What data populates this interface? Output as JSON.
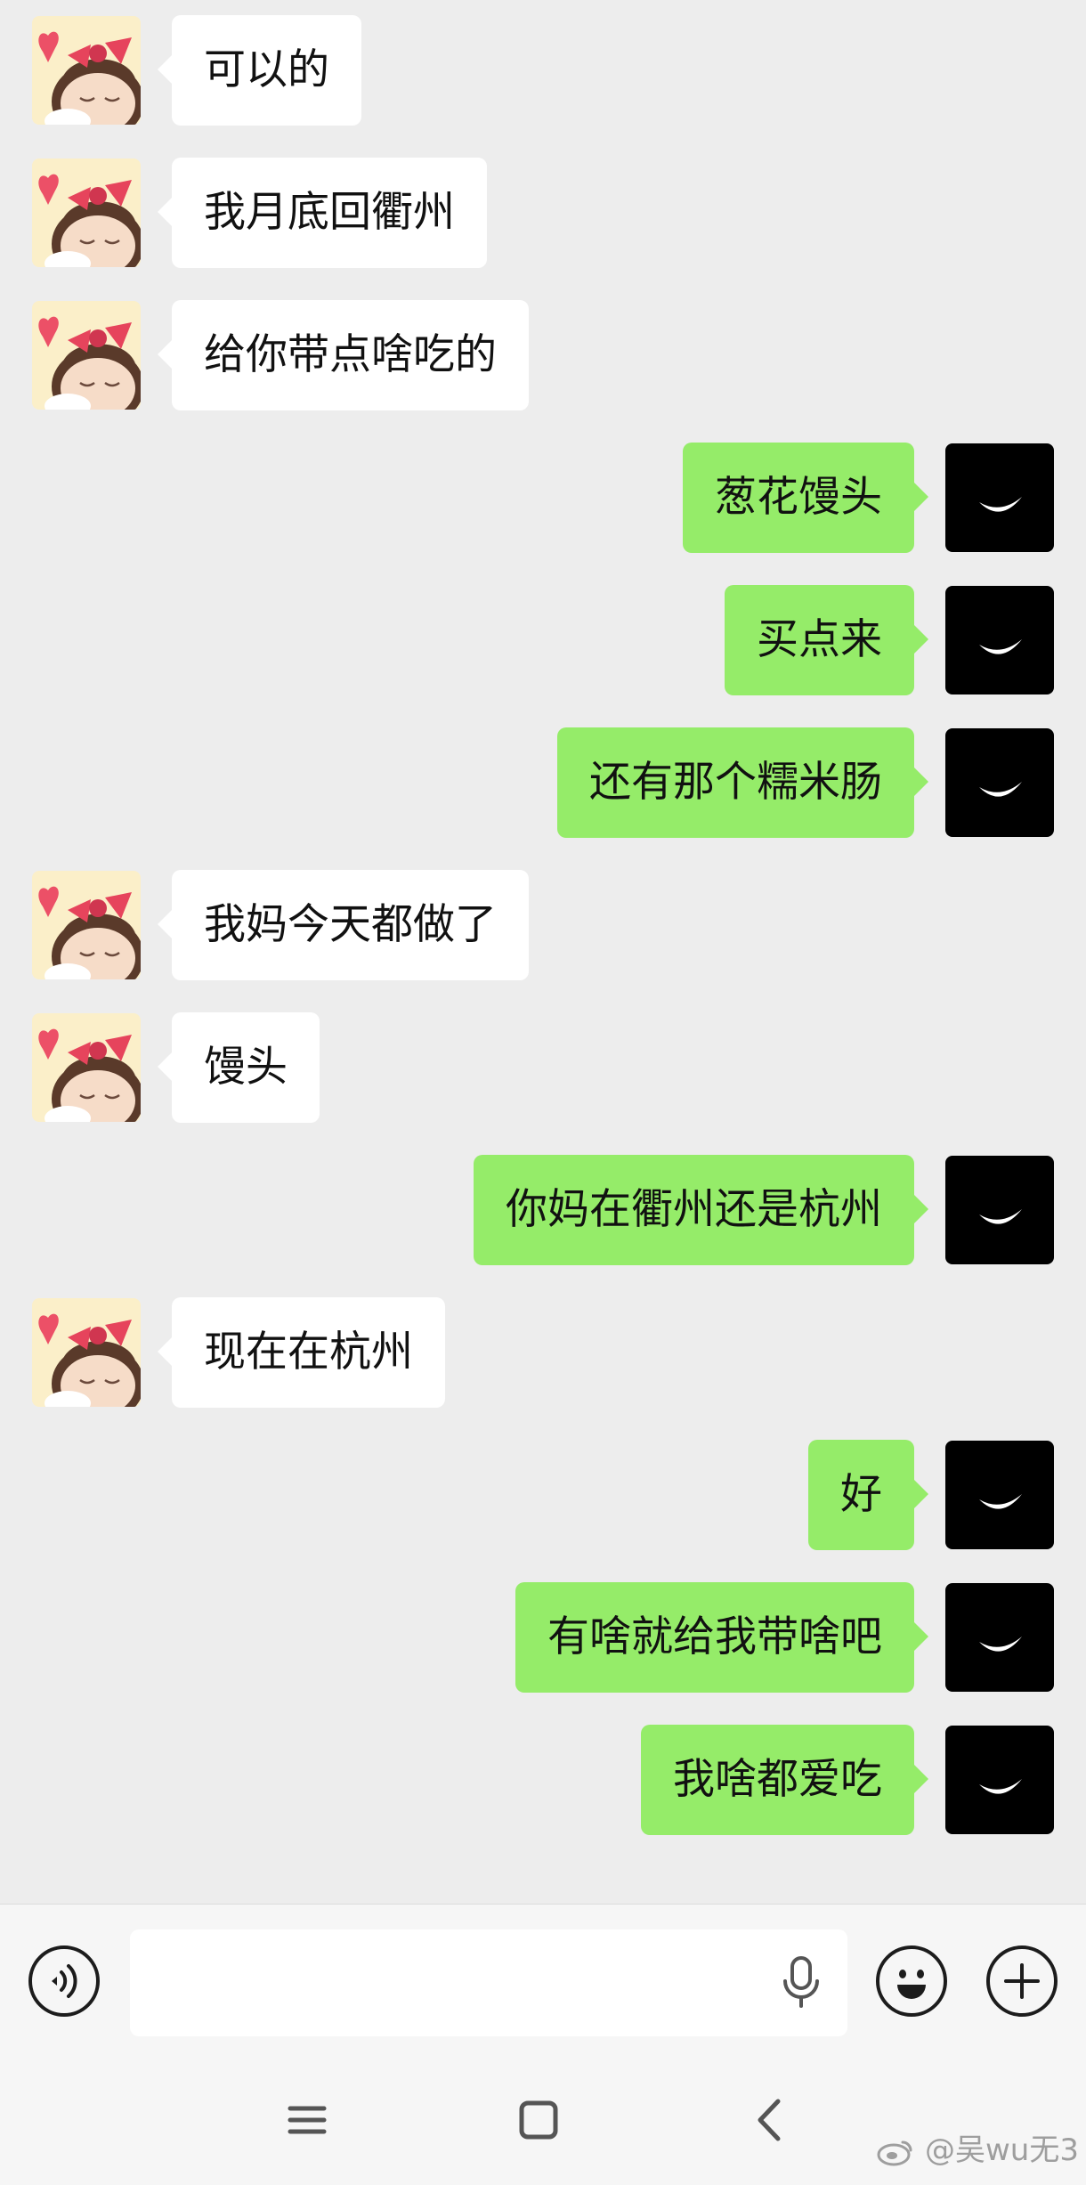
{
  "conversation": {
    "messages": [
      {
        "side": "in",
        "text": "可以的"
      },
      {
        "side": "in",
        "text": "我月底回衢州"
      },
      {
        "side": "in",
        "text": "给你带点啥吃的"
      },
      {
        "side": "out",
        "text": "葱花馒头"
      },
      {
        "side": "out",
        "text": "买点来"
      },
      {
        "side": "out",
        "text": "还有那个糯米肠"
      },
      {
        "side": "in",
        "text": "我妈今天都做了"
      },
      {
        "side": "in",
        "text": "馒头"
      },
      {
        "side": "out",
        "text": "你妈在衢州还是杭州"
      },
      {
        "side": "in",
        "text": "现在在杭州"
      },
      {
        "side": "out",
        "text": "好"
      },
      {
        "side": "out",
        "text": "有啥就给我带啥吧"
      },
      {
        "side": "out",
        "text": "我啥都爱吃"
      }
    ]
  },
  "input_bar": {
    "message_value": "",
    "icons": {
      "voice": "voice-mode-icon",
      "mic": "microphone-icon",
      "emoji": "emoji-icon",
      "plus": "plus-icon"
    }
  },
  "nav_bar": {
    "icons": [
      "menu-icon",
      "home-icon",
      "back-icon"
    ]
  },
  "watermark": {
    "text": "@吴wu无3"
  },
  "colors": {
    "chat_background": "#ededed",
    "incoming_bubble": "#ffffff",
    "outgoing_bubble": "#95ec69",
    "input_bar_background": "#f6f6f6"
  }
}
